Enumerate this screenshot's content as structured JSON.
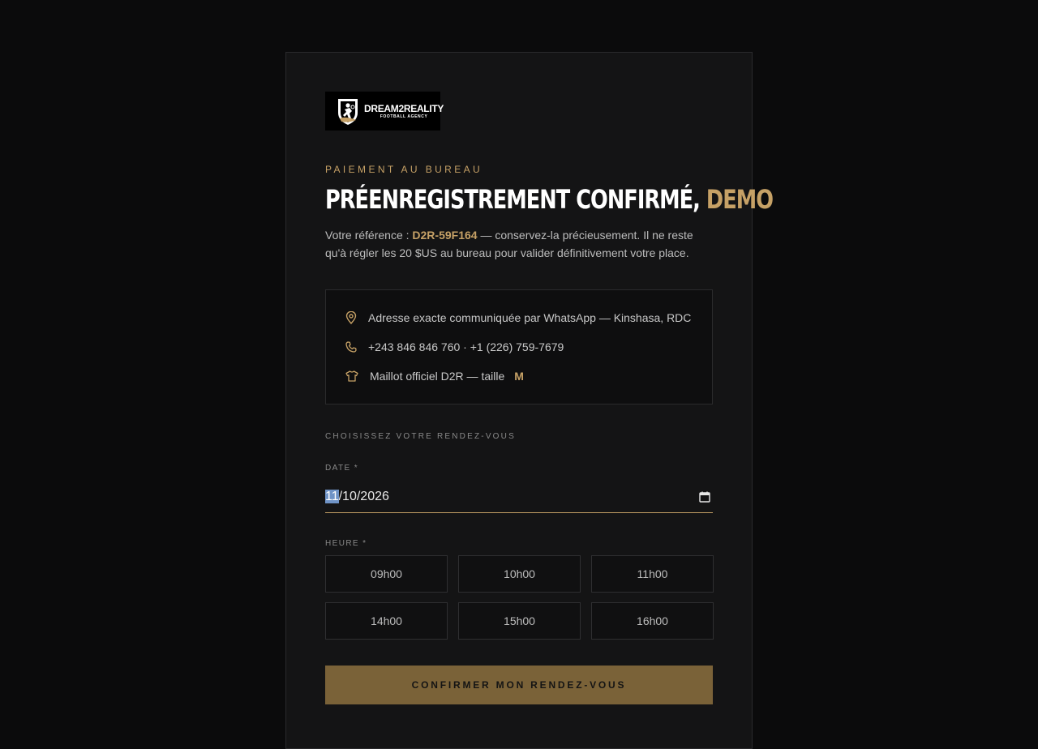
{
  "brand": {
    "name": "DREAM2REALITY",
    "tagline": "FOOTBALL AGENCY"
  },
  "eyebrow": "PAIEMENT AU BUREAU",
  "headline": {
    "main": "PRÉENREGISTREMENT CONFIRMÉ,",
    "name": "DEMO"
  },
  "intro": {
    "prefix": "Votre référence : ",
    "reference": "D2R-59F164",
    "suffix": " — conservez-la précieusement. Il ne reste qu'à régler les 20 $US au bureau pour valider définitivement votre place."
  },
  "info": {
    "address": "Adresse exacte communiquée par WhatsApp — Kinshasa, RDC",
    "phones": "+243 846 846 760 · +1 (226) 759-7679",
    "jersey": "Maillot officiel D2R — taille",
    "size": "M"
  },
  "appointment": {
    "section_label": "CHOISISSEZ VOTRE RENDEZ-VOUS",
    "date_label": "DATE *",
    "date_day": "11",
    "date_rest": "/10/2026",
    "time_label": "HEURE *",
    "slots": [
      "09h00",
      "10h00",
      "11h00",
      "14h00",
      "15h00",
      "16h00"
    ]
  },
  "confirm_label": "CONFIRMER MON RENDEZ-VOUS",
  "colors": {
    "accent": "#c6a166",
    "button": "#7a6238",
    "background": "#0b0b0c",
    "card": "#141415"
  },
  "icons": {
    "address": "map-pin-icon",
    "phones": "phone-icon",
    "jersey": "shirt-icon",
    "date": "calendar-icon"
  }
}
